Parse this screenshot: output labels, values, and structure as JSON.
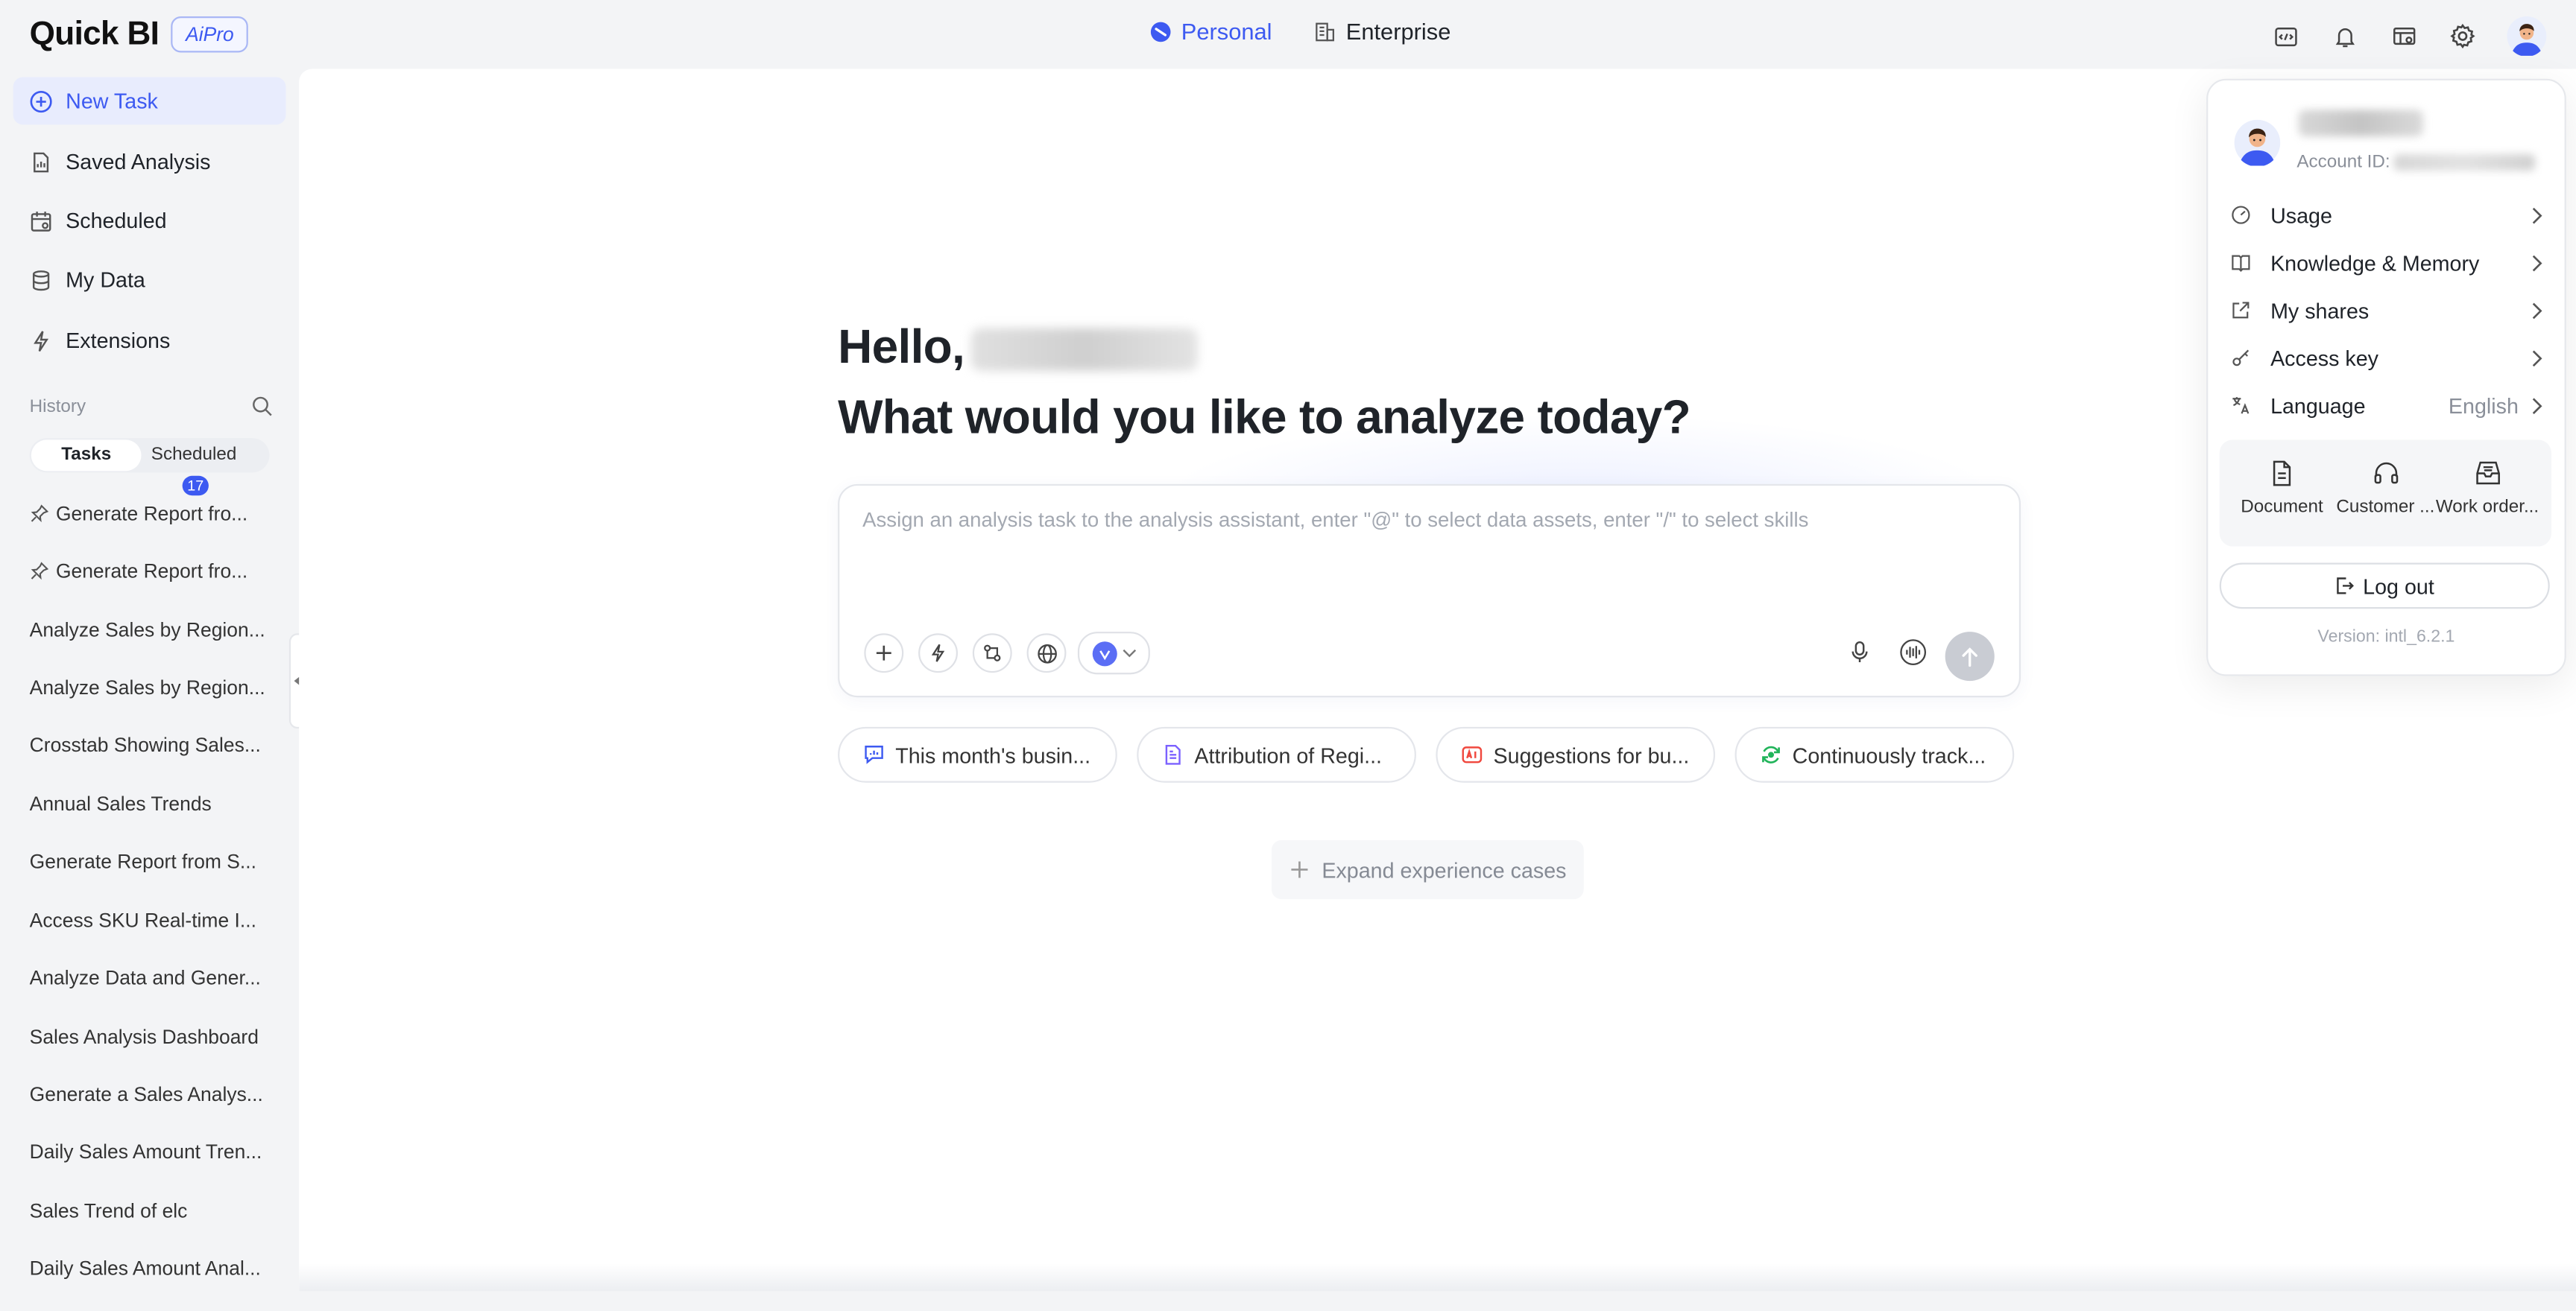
{
  "header": {
    "logo": "Quick BI",
    "badge": "AiPro",
    "tabs": [
      {
        "label": "Personal",
        "active": true
      },
      {
        "label": "Enterprise",
        "active": false
      }
    ]
  },
  "sidebar": {
    "nav": [
      {
        "label": "New Task",
        "icon": "plus-circle-icon",
        "active": true
      },
      {
        "label": "Saved Analysis",
        "icon": "file-chart-icon"
      },
      {
        "label": "Scheduled",
        "icon": "calendar-icon"
      },
      {
        "label": "My Data",
        "icon": "database-icon"
      },
      {
        "label": "Extensions",
        "icon": "lightning-icon"
      }
    ],
    "history_label": "History",
    "tabs": {
      "tasks": "Tasks",
      "scheduled": "Scheduled",
      "scheduled_count": "17"
    },
    "items": [
      "Generate Report fro...",
      "Generate Report fro...",
      "Analyze Sales by Region...",
      "Analyze Sales by Region...",
      "Crosstab Showing Sales...",
      "Annual Sales Trends",
      "Generate Report from S...",
      "Access SKU Real-time I...",
      "Analyze Data and Gener...",
      "Sales Analysis Dashboard",
      "Generate a Sales Analys...",
      "Daily Sales Amount Tren...",
      "Sales Trend of elc",
      "Daily Sales Amount Anal..."
    ]
  },
  "main": {
    "greeting": "Hello,",
    "question": "What would you like to analyze today?",
    "input_placeholder": "Assign an analysis task to the analysis assistant, enter \"@\" to select data assets, enter \"/\" to select skills",
    "chips": [
      {
        "label": "This month's busin...",
        "icon": "chat-chart-icon",
        "color": "#3d5af1"
      },
      {
        "label": "Attribution of Regi...",
        "icon": "doc-analysis-icon",
        "color": "#7b61ff"
      },
      {
        "label": "Suggestions for bu...",
        "icon": "ai-suggest-icon",
        "color": "#f0483e"
      },
      {
        "label": "Continuously track...",
        "icon": "track-refresh-icon",
        "color": "#21b45a"
      }
    ],
    "expand_label": "Expand experience cases"
  },
  "popover": {
    "account_prefix": "Account ID:",
    "menu": [
      {
        "label": "Usage",
        "icon": "gauge-icon",
        "value": ""
      },
      {
        "label": "Knowledge & Memory",
        "icon": "book-icon",
        "value": ""
      },
      {
        "label": "My shares",
        "icon": "share-icon",
        "value": ""
      },
      {
        "label": "Access key",
        "icon": "key-icon",
        "value": ""
      },
      {
        "label": "Language",
        "icon": "translate-icon",
        "value": "English"
      }
    ],
    "quick": [
      {
        "label": "Document",
        "icon": "document-icon"
      },
      {
        "label": "Customer ...",
        "icon": "headset-icon"
      },
      {
        "label": "Work order...",
        "icon": "inbox-icon"
      }
    ],
    "logout": "Log out",
    "version": "Version:  intl_6.2.1"
  },
  "colors": {
    "accent": "#3d5af1",
    "badge": "#3d5af1"
  }
}
